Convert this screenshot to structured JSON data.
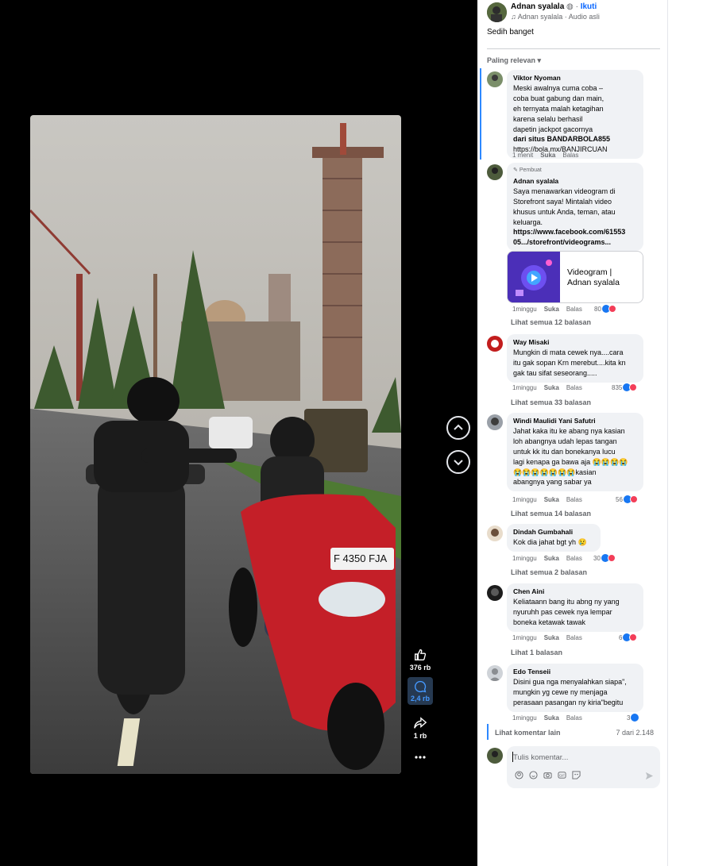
{
  "post": {
    "author": "Adnan syalala",
    "follow": "Ikuti",
    "audio": "Adnan syalala · Audio asli",
    "caption": "Sedih banget"
  },
  "sort_label": "Paling relevan",
  "rail": {
    "likes": "376 rb",
    "comments": "2,4 rb",
    "shares": "1 rb"
  },
  "comments": [
    {
      "name": "Viktor Nyoman",
      "lines": [
        "Meski awalnya cuma coba –",
        "coba buat gabung dan main,",
        "eh ternyata malah ketagihan",
        "karena selalu berhasil",
        "dapetin jackpot gacornya",
        "dari situs BANDARBOLA855",
        "https://bola.mx/BANJIRCUAN"
      ],
      "time": "1 menit",
      "like": "Suka",
      "reply": "Balas"
    },
    {
      "author_tag": "Pembuat",
      "name": "Adnan syalala",
      "lines": [
        "Saya menawarkan videogram di",
        "Storefront saya! Mintalah video",
        "khusus untuk Anda, teman, atau",
        "keluarga.",
        "https://www.facebook.com/61553",
        "05.../storefront/videograms..."
      ],
      "link_title": "Videogram | Adnan syalala",
      "time": "1minggu",
      "like": "Suka",
      "reply": "Balas",
      "reactions": "80",
      "replies": "Lihat semua 12 balasan"
    },
    {
      "name": "Way Misaki",
      "lines": [
        "Mungkin di mata cewek nya....cara",
        "itu gak sopan Krn merebut....kita kn",
        "gak tau sifat seseorang....."
      ],
      "time": "1minggu",
      "like": "Suka",
      "reply": "Balas",
      "reactions": "835",
      "replies": "Lihat semua 33 balasan"
    },
    {
      "name": "Windi Maulidi Yani Safutri",
      "lines": [
        "Jahat kaka itu ke abang nya kasian",
        "loh abangnya udah lepas tangan",
        "untuk kk itu dan bonekanya lucu",
        "lagi kenapa ga bawa aja 😭😭😭😭",
        "😭😭😭😭😭😭😭kasian",
        "abangnya yang sabar ya"
      ],
      "time": "1minggu",
      "like": "Suka",
      "reply": "Balas",
      "reactions": "56",
      "replies": "Lihat semua 14 balasan"
    },
    {
      "name": "Dindah Gumbahali",
      "lines": [
        "Kok dia jahat bgt yh 😢"
      ],
      "time": "1minggu",
      "like": "Suka",
      "reply": "Balas",
      "reactions": "30",
      "replies": "Lihat semua 2 balasan"
    },
    {
      "name": "Chen Aini",
      "lines": [
        "Keliataann bang itu abng ny yang",
        "nyuruhh pas cewek nya lempar",
        "boneka ketawak tawak"
      ],
      "time": "1minggu",
      "like": "Suka",
      "reply": "Balas",
      "reactions": "6",
      "replies": "Lihat 1 balasan"
    },
    {
      "name": "Edo Tenseii",
      "lines": [
        "Disini gua nga menyalahkan siapa\",",
        "mungkin yg cewe ny menjaga",
        "perasaan pasangan ny kiria\"begitu"
      ],
      "time": "1minggu",
      "like": "Suka",
      "reply": "Balas",
      "reactions": "3"
    }
  ],
  "more_comments": "Lihat komentar lain",
  "comment_count": "7 dari 2.148",
  "composer_placeholder": "Tulis komentar...",
  "colors": {
    "accent": "#0866ff",
    "thread": "#2d88ff",
    "like": "#1877f2",
    "love": "#f33e58"
  }
}
